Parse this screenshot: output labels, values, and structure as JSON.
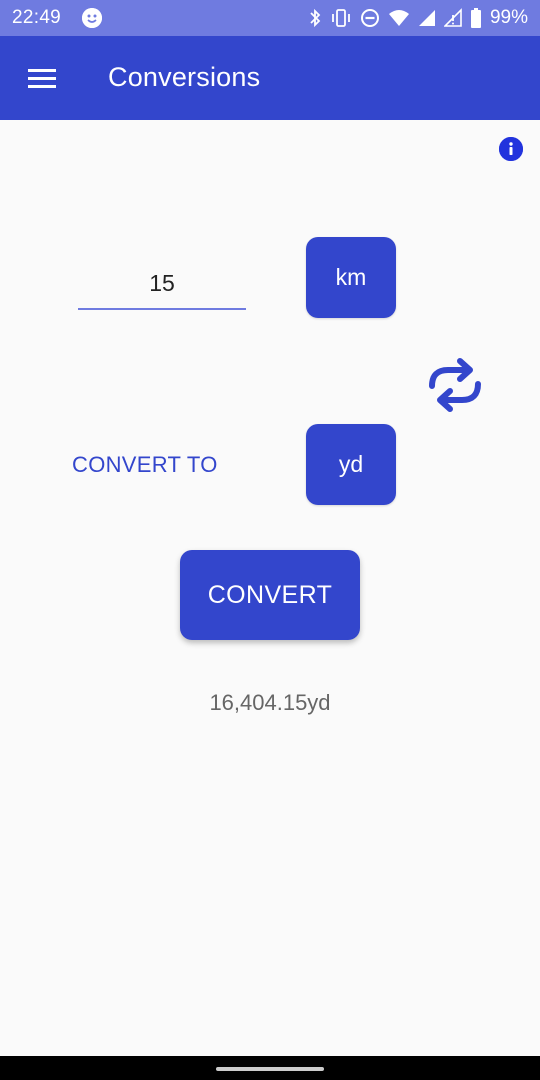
{
  "status_bar": {
    "time": "22:49",
    "battery_text": "99%",
    "icons": [
      "smiley-face-icon",
      "bluetooth-icon",
      "vibrate-icon",
      "do-not-disturb-icon",
      "wifi-icon",
      "signal-icon",
      "signal-off-icon",
      "battery-icon"
    ]
  },
  "app_bar": {
    "title": "Conversions",
    "menu_icon": "hamburger-menu-icon"
  },
  "info_icon": "info-icon",
  "input": {
    "value": "15"
  },
  "from_unit": {
    "label": "km"
  },
  "swap_icon": "swap-arrows-icon",
  "convert_to": {
    "label": "CONVERT TO"
  },
  "to_unit": {
    "label": "yd"
  },
  "convert_button": {
    "label": "CONVERT"
  },
  "result": {
    "text": "16,404.15yd"
  },
  "colors": {
    "primary": "#3346cc",
    "status_bar": "#6f7be0",
    "background": "#fafafa",
    "result_text": "#666666"
  }
}
